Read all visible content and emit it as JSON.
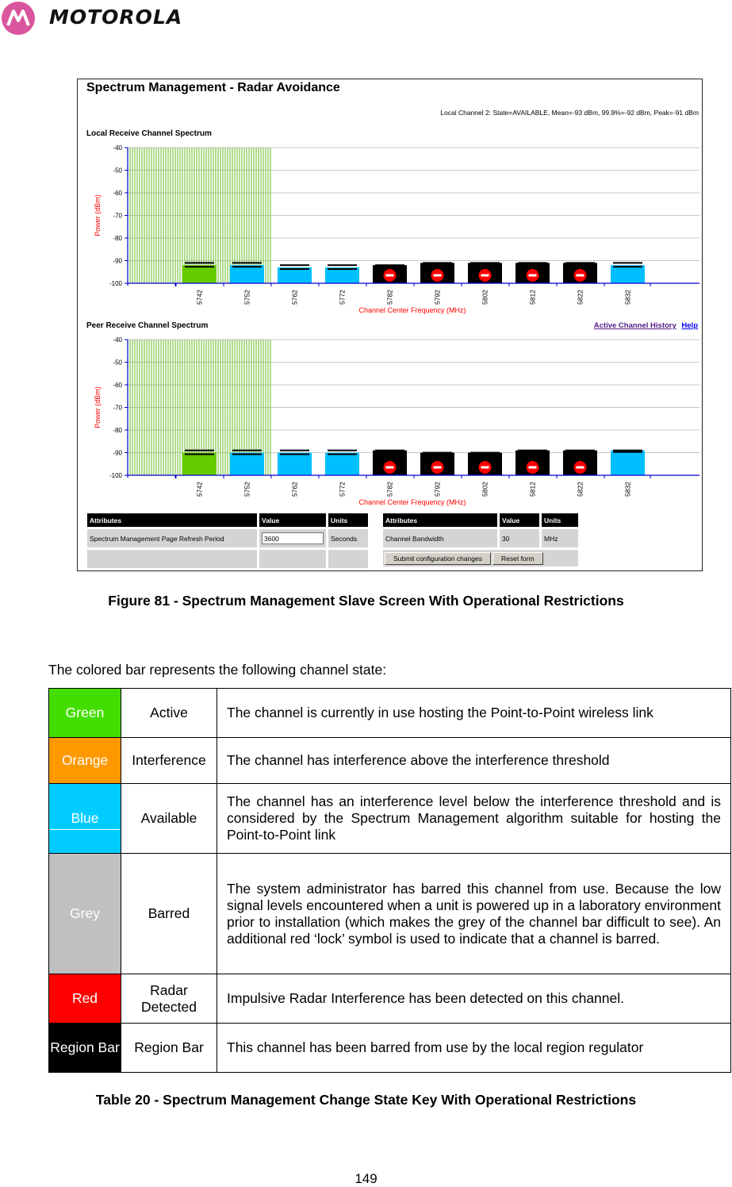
{
  "header": {
    "brand": "MOTOROLA"
  },
  "screen": {
    "title": "Spectrum Management - Radar Avoidance",
    "status_line": "Local Channel 2: State=AVAILABLE, Mean=-93 dBm, 99.9%=-92 dBm, Peak=-91 dBm",
    "links": {
      "active_channel_history": "Active Channel History",
      "help": "Help"
    },
    "local_panel_label": "Local Receive Channel Spectrum",
    "peer_panel_label": "Peer Receive Channel Spectrum",
    "left_table": {
      "headers": [
        "Attributes",
        "Value",
        "Units"
      ],
      "rows": [
        {
          "attribute": "Spectrum Management Page Refresh Period",
          "value": "3600",
          "units": "Seconds"
        }
      ]
    },
    "right_table": {
      "headers": [
        "Attributes",
        "Value",
        "Units"
      ],
      "rows": [
        {
          "attribute": "Channel Bandwidth",
          "value": "30",
          "units": "MHz"
        }
      ],
      "buttons": {
        "submit": "Submit configuration changes",
        "reset": "Reset form"
      }
    }
  },
  "colors": {
    "active": "#66cc00",
    "available": "#00bfff",
    "region_bar": "#000000",
    "radar_icon": "#ff0000",
    "axis": "#0000cc",
    "axis_label": "#ff0000",
    "hatch": "#66bb22"
  },
  "chart_data": [
    {
      "type": "bar",
      "title": "Local Receive Channel Spectrum",
      "xlabel": "Channel Center Frequency (MHz)",
      "ylabel": "Power (dBm)",
      "ylim": [
        -100,
        -40
      ],
      "yticks": [
        -40,
        -50,
        -60,
        -70,
        -80,
        -90,
        -100
      ],
      "grid": true,
      "categories": [
        "5742",
        "5752",
        "5762",
        "5772",
        "5782",
        "5792",
        "5802",
        "5812",
        "5822",
        "5832"
      ],
      "series": [
        {
          "name": "mean_power_dBm",
          "values": [
            -92,
            -92,
            -93,
            -93,
            -92,
            -91,
            -91,
            -91,
            -91,
            -92
          ]
        },
        {
          "name": "peak_power_dBm",
          "values": [
            -91,
            -91,
            -92,
            -92,
            -92,
            -91,
            -91,
            -91,
            -91,
            -91
          ]
        }
      ],
      "states": [
        "active",
        "available",
        "available",
        "available",
        "region_bar",
        "region_bar",
        "region_bar",
        "region_bar",
        "region_bar",
        "available"
      ],
      "radar_detected": [
        false,
        false,
        false,
        false,
        true,
        true,
        true,
        true,
        true,
        false
      ],
      "hatched_region_mhz": [
        5727,
        5757
      ]
    },
    {
      "type": "bar",
      "title": "Peer Receive Channel Spectrum",
      "xlabel": "Channel Center Frequency (MHz)",
      "ylabel": "Power (dBm)",
      "ylim": [
        -100,
        -40
      ],
      "yticks": [
        -40,
        -50,
        -60,
        -70,
        -80,
        -90,
        -100
      ],
      "grid": true,
      "categories": [
        "5742",
        "5752",
        "5762",
        "5772",
        "5782",
        "5792",
        "5802",
        "5812",
        "5822",
        "5832"
      ],
      "series": [
        {
          "name": "mean_power_dBm",
          "values": [
            -90,
            -90,
            -90,
            -90,
            -90,
            -90,
            -90,
            -89,
            -89,
            -89
          ]
        },
        {
          "name": "peak_power_dBm",
          "values": [
            -89,
            -89,
            -89,
            -89,
            -89,
            -90,
            -90,
            -89,
            -89,
            -89
          ]
        }
      ],
      "states": [
        "active",
        "available",
        "available",
        "available",
        "region_bar",
        "region_bar",
        "region_bar",
        "region_bar",
        "region_bar",
        "available"
      ],
      "radar_detected": [
        false,
        false,
        false,
        false,
        true,
        true,
        true,
        true,
        true,
        false
      ],
      "hatched_region_mhz": [
        5727,
        5757
      ]
    }
  ],
  "figure_caption": "Figure 81 - Spectrum Management Slave Screen With Operational Restrictions",
  "intro_text": "The colored bar represents the following channel state:",
  "key_table": [
    {
      "color_name": "Green",
      "color": "#44dd00",
      "state": "Active",
      "description": "The channel is currently in use hosting the Point-to-Point wireless link"
    },
    {
      "color_name": "Orange",
      "color": "#ff9900",
      "state": "Interference",
      "description": "The channel has interference above the interference threshold"
    },
    {
      "color_name": "Blue",
      "color": "#00ccff",
      "state": "Available",
      "description": "The channel has an interference level below the interference threshold and is considered by the Spectrum Management algorithm suitable for hosting the Point-to-Point link"
    },
    {
      "color_name": "Grey",
      "color": "#c0c0c0",
      "state": "Barred",
      "description": "The system administrator has barred this channel from use. Because the low signal levels encountered when a unit is powered up in a laboratory environment prior to installation (which makes the grey of the channel bar difficult to see). An additional red ‘lock’ symbol is used to indicate that a channel is barred."
    },
    {
      "color_name": "Red",
      "color": "#ff0000",
      "state": "Radar Detected",
      "description": "Impulsive Radar Interference has been detected on this channel."
    },
    {
      "color_name": "Region Bar",
      "color": "#000000",
      "state": "Region Bar",
      "description": "This channel has been barred from use by the local region regulator"
    }
  ],
  "table_caption": "Table 20 - Spectrum Management Change State Key With Operational Restrictions",
  "page_number": "149"
}
